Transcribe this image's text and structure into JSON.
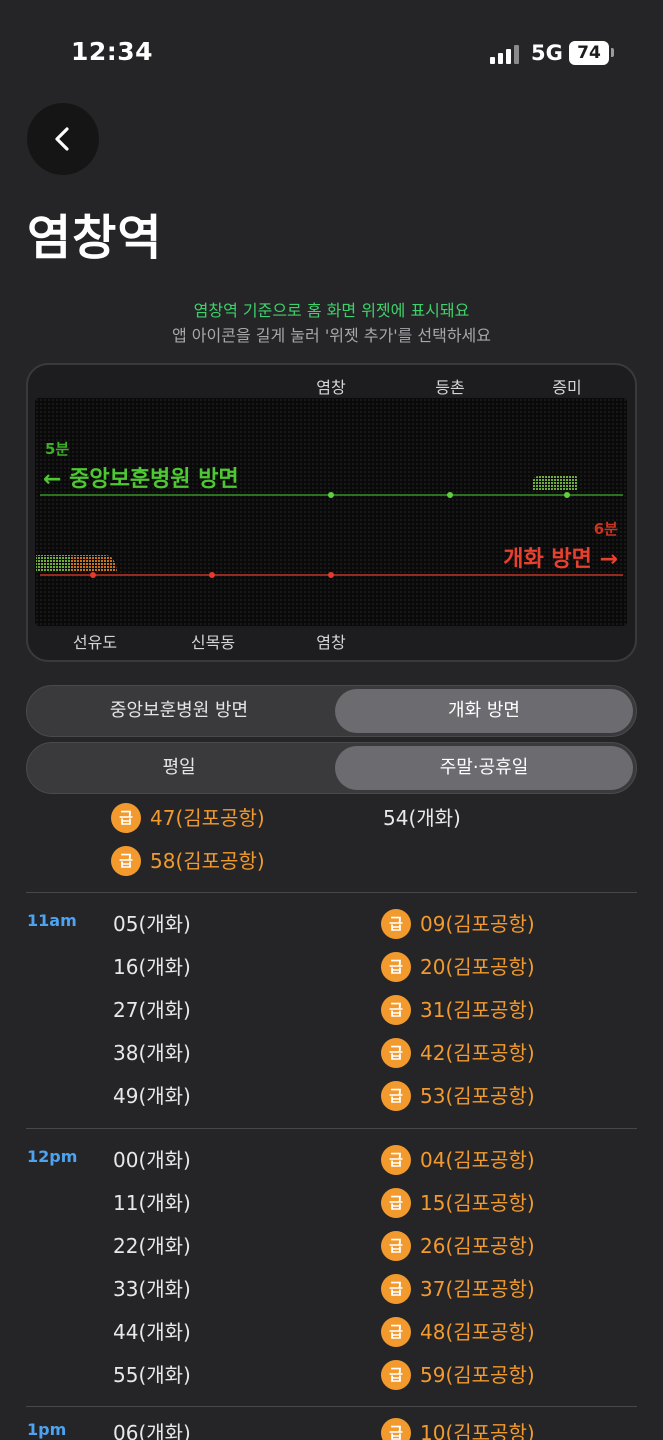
{
  "status_bar": {
    "time": "12:34",
    "network": "5G",
    "battery": "74"
  },
  "page": {
    "title": "염창역"
  },
  "hint": {
    "line1": "염창역 기준으로 홈 화면 위젯에 표시돼요",
    "line2": "앱 아이콘을 길게 눌러 '위젯 추가'를 선택하세요"
  },
  "widget": {
    "top_stations": [
      "염창",
      "등촌",
      "증미"
    ],
    "bottom_stations": [
      "선유도",
      "신목동",
      "염창"
    ],
    "upper_track": {
      "minutes": "5분",
      "direction": "← 중앙보훈병원 방면",
      "color": "#3fae2a"
    },
    "lower_track": {
      "minutes": "6분",
      "direction": "개화 방면 →",
      "color": "#e53b2c"
    }
  },
  "direction_segment": {
    "options": [
      "중앙보훈병원 방면",
      "개화 방면"
    ],
    "selected_index": 1
  },
  "day_segment": {
    "options": [
      "평일",
      "주말·공휴일"
    ],
    "selected_index": 1
  },
  "express_badge": "급",
  "timetable": [
    {
      "hour": "",
      "left": [
        {
          "t": "47(김포공항)",
          "express": true
        },
        {
          "t": "58(김포공항)",
          "express": true
        }
      ],
      "right": [
        {
          "t": "54(개화)",
          "express": false
        }
      ]
    },
    {
      "hour": "11am",
      "left": [
        {
          "t": "05(개화)",
          "express": false
        },
        {
          "t": "16(개화)",
          "express": false
        },
        {
          "t": "27(개화)",
          "express": false
        },
        {
          "t": "38(개화)",
          "express": false
        },
        {
          "t": "49(개화)",
          "express": false
        }
      ],
      "right": [
        {
          "t": "09(김포공항)",
          "express": true
        },
        {
          "t": "20(김포공항)",
          "express": true
        },
        {
          "t": "31(김포공항)",
          "express": true
        },
        {
          "t": "42(김포공항)",
          "express": true
        },
        {
          "t": "53(김포공항)",
          "express": true
        }
      ]
    },
    {
      "hour": "12pm",
      "left": [
        {
          "t": "00(개화)",
          "express": false
        },
        {
          "t": "11(개화)",
          "express": false
        },
        {
          "t": "22(개화)",
          "express": false
        },
        {
          "t": "33(개화)",
          "express": false
        },
        {
          "t": "44(개화)",
          "express": false
        },
        {
          "t": "55(개화)",
          "express": false
        }
      ],
      "right": [
        {
          "t": "04(김포공항)",
          "express": true
        },
        {
          "t": "15(김포공항)",
          "express": true
        },
        {
          "t": "26(김포공항)",
          "express": true
        },
        {
          "t": "37(김포공항)",
          "express": true
        },
        {
          "t": "48(김포공항)",
          "express": true
        },
        {
          "t": "59(김포공항)",
          "express": true
        }
      ]
    },
    {
      "hour": "1pm",
      "left": [
        {
          "t": "06(개화)",
          "express": false
        }
      ],
      "right": [
        {
          "t": "10(김포공항)",
          "express": true
        }
      ]
    }
  ]
}
